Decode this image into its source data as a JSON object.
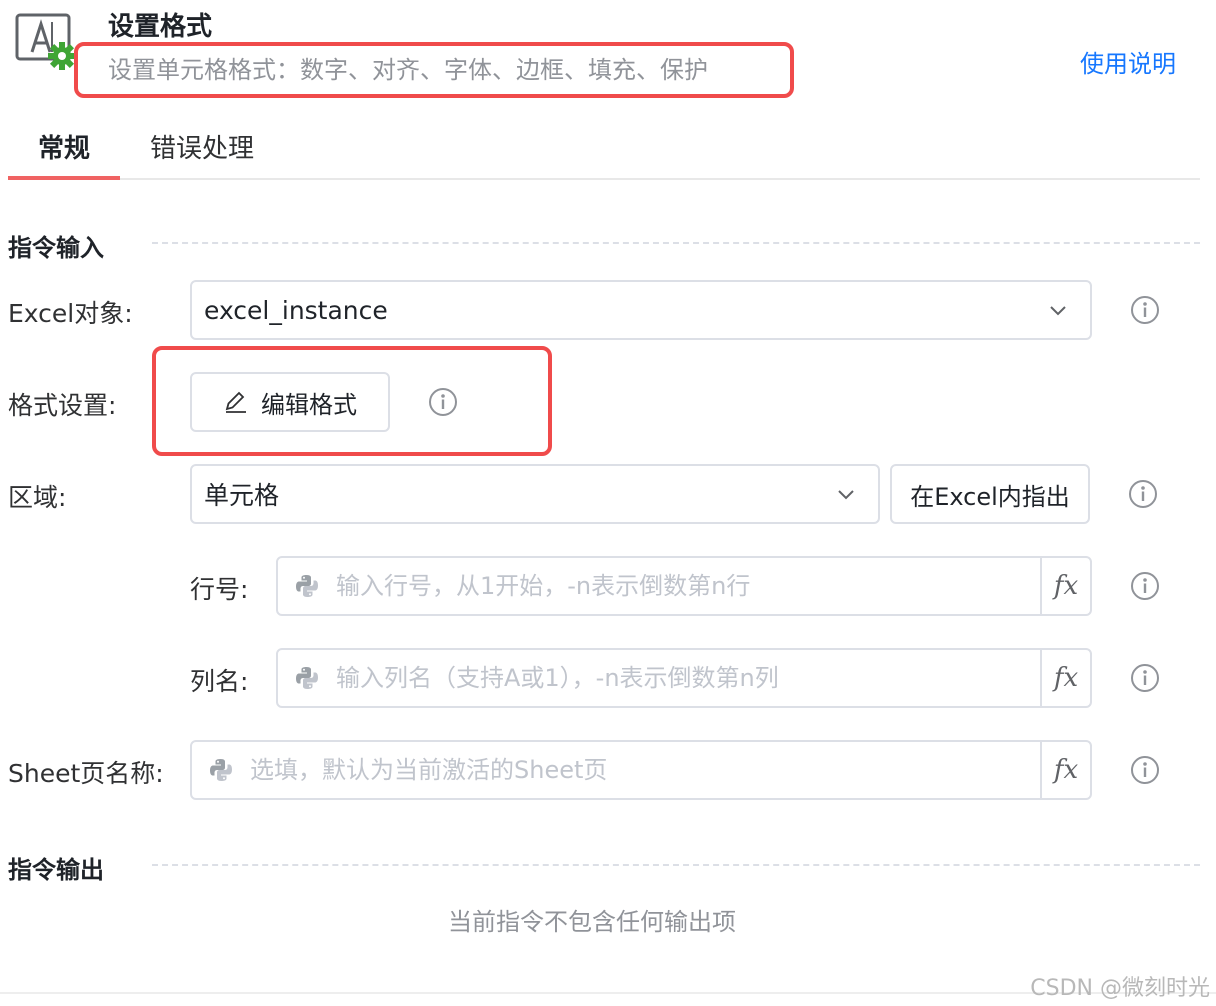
{
  "header": {
    "title": "设置格式",
    "subtitle": "设置单元格格式：数字、对齐、字体、边框、填充、保护",
    "help_link": "使用说明",
    "icon": "excel-format-gear-icon"
  },
  "tabs": [
    {
      "label": "常规",
      "active": true
    },
    {
      "label": "错误处理",
      "active": false
    }
  ],
  "sections": {
    "input_title": "指令输入",
    "output_title": "指令输出",
    "output_empty": "当前指令不包含任何输出项"
  },
  "fields": {
    "excel_object": {
      "label": "Excel对象:",
      "value": "excel_instance"
    },
    "format": {
      "label": "格式设置:",
      "button": "编辑格式"
    },
    "region": {
      "label": "区域:",
      "value": "单元格",
      "point_button": "在Excel内指出"
    },
    "row": {
      "label": "行号:",
      "placeholder": "输入行号，从1开始，-n表示倒数第n行"
    },
    "column": {
      "label": "列名:",
      "placeholder": "输入列名（支持A或1），-n表示倒数第n列"
    },
    "sheet": {
      "label": "Sheet页名称:",
      "placeholder": "选填，默认为当前激活的Sheet页"
    }
  },
  "fx_label": "fx",
  "watermark": "CSDN @微刻时光",
  "colors": {
    "accent": "#1677ff",
    "tab_ink": "#f06262",
    "highlight_box": "#f04b4b",
    "gear": "#3fa535"
  }
}
